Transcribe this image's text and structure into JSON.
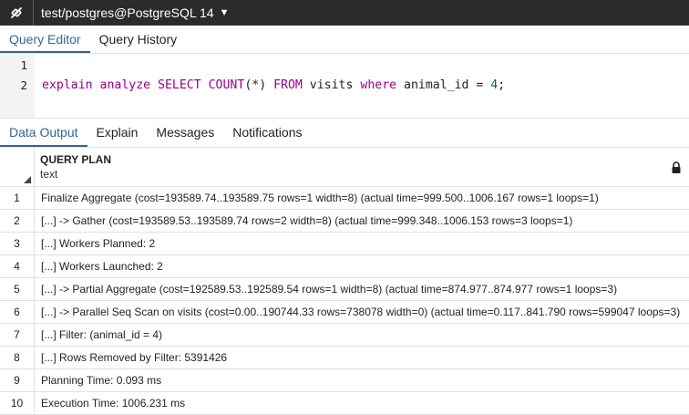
{
  "topbar": {
    "connection_title": "test/postgres@PostgreSQL 14",
    "icons": [
      "connection-icon",
      "chevron-down-icon"
    ]
  },
  "editor_tabs": [
    "Query Editor",
    "Query History"
  ],
  "editor": {
    "line_numbers": [
      "1",
      "2"
    ],
    "line2_tokens": {
      "t1": "explain analyze SELECT COUNT",
      "t2": "(*)",
      "t3": " FROM",
      "t4": " visits ",
      "t5": "where",
      "t6": " animal_id = ",
      "t7": "4",
      "t8": ";"
    }
  },
  "output_tabs": [
    "Data Output",
    "Explain",
    "Messages",
    "Notifications"
  ],
  "grid": {
    "column_name": "QUERY PLAN",
    "column_type": "text",
    "rows": [
      {
        "idx": "1",
        "value": "Finalize Aggregate  (cost=193589.74..193589.75 rows=1 width=8) (actual time=999.500..1006.167 rows=1 loops=1)"
      },
      {
        "idx": "2",
        "value": "[...] ->  Gather  (cost=193589.53..193589.74 rows=2 width=8) (actual time=999.348..1006.153 rows=3 loops=1)"
      },
      {
        "idx": "3",
        "value": "[...] Workers Planned: 2"
      },
      {
        "idx": "4",
        "value": "[...] Workers Launched: 2"
      },
      {
        "idx": "5",
        "value": "[...] ->  Partial Aggregate  (cost=192589.53..192589.54 rows=1 width=8) (actual time=874.977..874.977 rows=1 loops=3)"
      },
      {
        "idx": "6",
        "value": "[...] ->  Parallel Seq Scan on visits  (cost=0.00..190744.33 rows=738078 width=0) (actual time=0.117..841.790 rows=599047 loops=3)"
      },
      {
        "idx": "7",
        "value": "[...] Filter: (animal_id = 4)"
      },
      {
        "idx": "8",
        "value": "[...] Rows Removed by Filter: 5391426"
      },
      {
        "idx": "9",
        "value": "Planning Time: 0.093 ms"
      },
      {
        "idx": "10",
        "value": "Execution Time: 1006.231 ms"
      }
    ]
  },
  "colors": {
    "topbar_bg": "#2b2b2b",
    "accent": "#326690",
    "keyword": "#990088",
    "number": "#116644"
  }
}
